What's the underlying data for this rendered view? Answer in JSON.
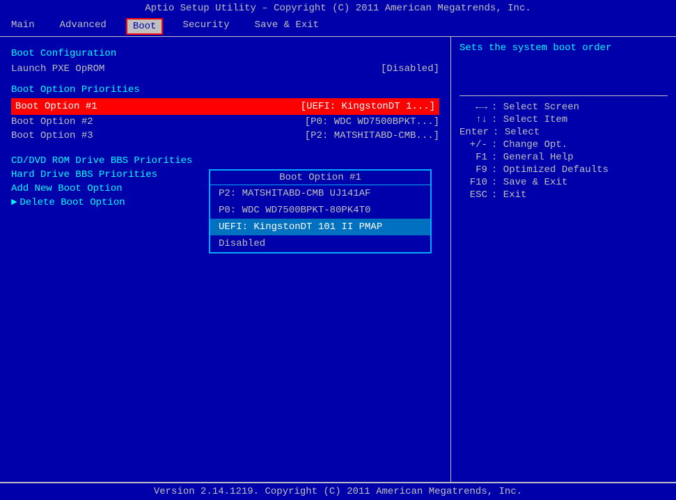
{
  "titleBar": {
    "text": "Aptio Setup Utility – Copyright (C) 2011 American Megatrends, Inc."
  },
  "menuBar": {
    "items": [
      {
        "id": "main",
        "label": "Main",
        "active": false
      },
      {
        "id": "advanced",
        "label": "Advanced",
        "active": false
      },
      {
        "id": "boot",
        "label": "Boot",
        "active": true
      },
      {
        "id": "security",
        "label": "Security",
        "active": false
      },
      {
        "id": "save-exit",
        "label": "Save & Exit",
        "active": false
      }
    ]
  },
  "leftPanel": {
    "bootConfig": {
      "title": "Boot Configuration",
      "launchPXE": {
        "label": "Launch PXE OpROM",
        "value": "[Disabled]"
      }
    },
    "bootPriorities": {
      "title": "Boot Option Priorities",
      "options": [
        {
          "label": "Boot Option #1",
          "value": "[UEFI: KingstonDT 1...]",
          "highlighted": true
        },
        {
          "label": "Boot Option #2",
          "value": "[P0: WDC WD7500BPKT...]"
        },
        {
          "label": "Boot Option #3",
          "value": "[P2: MATSHITABD-CMB...]"
        }
      ]
    },
    "menuLinks": [
      "CD/DVD ROM Drive BBS Priorities",
      "Hard Drive BBS Priorities",
      "Add New Boot Option"
    ],
    "arrowItem": "Delete Boot Option"
  },
  "dropdown": {
    "title": "Boot Option #1",
    "items": [
      {
        "label": "P2: MATSHITABD-CMB UJ141AF",
        "selected": false
      },
      {
        "label": "P0: WDC WD7500BPKT-80PK4T0",
        "selected": false
      },
      {
        "label": "UEFI: KingstonDT 101 II PMAP",
        "selected": true
      },
      {
        "label": "Disabled",
        "selected": false
      }
    ]
  },
  "rightPanel": {
    "helpText": "Sets the system boot order",
    "keys": [
      {
        "key": "←→",
        "desc": ": Select Screen"
      },
      {
        "key": "↑↓",
        "desc": ": Select Item"
      },
      {
        "key": "Enter",
        "desc": ": Select"
      },
      {
        "key": "+/-",
        "desc": ": Change Opt."
      },
      {
        "key": "F1",
        "desc": ": General Help"
      },
      {
        "key": "F9",
        "desc": ": Optimized Defaults"
      },
      {
        "key": "F10",
        "desc": ": Save & Exit"
      },
      {
        "key": "ESC",
        "desc": ": Exit"
      }
    ]
  },
  "bottomBar": {
    "text": "Version 2.14.1219. Copyright (C) 2011 American Megatrends, Inc."
  }
}
